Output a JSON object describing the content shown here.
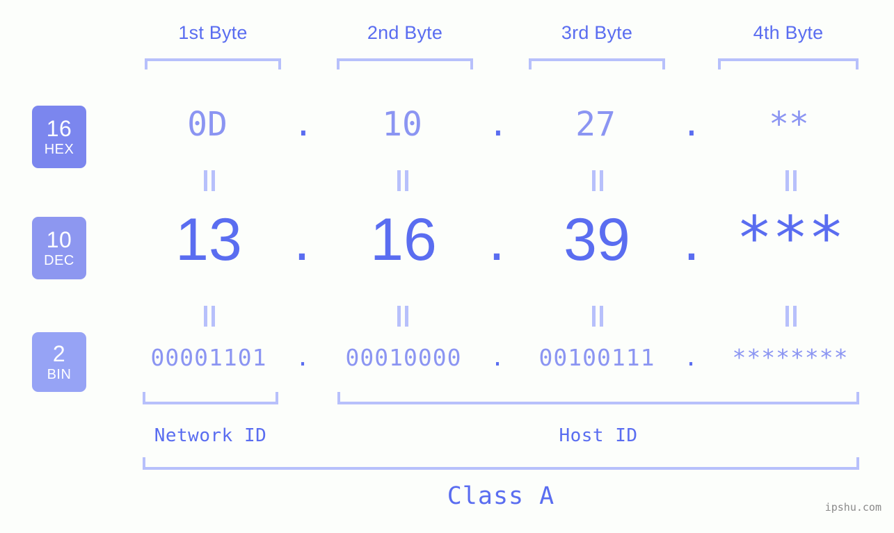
{
  "canvas": {
    "background_color": "#fcfefb",
    "accent_color": "#5a6df0",
    "light_accent_color": "#b7c0fb",
    "muted_value_color": "#8b95f2"
  },
  "byte_headers": [
    {
      "label": "1st Byte"
    },
    {
      "label": "2nd Byte"
    },
    {
      "label": "3rd Byte"
    },
    {
      "label": "4th Byte"
    }
  ],
  "radix_badges": [
    {
      "number": "16",
      "name": "HEX",
      "color": "#7b86ee"
    },
    {
      "number": "10",
      "name": "DEC",
      "color": "#8d97f0"
    },
    {
      "number": "2",
      "name": "BIN",
      "color": "#96a3f5"
    }
  ],
  "rows": {
    "hex": {
      "octets": [
        "0D",
        "10",
        "27",
        "**"
      ],
      "separator": "."
    },
    "dec": {
      "octets": [
        "13",
        "16",
        "39",
        "***"
      ],
      "separator": "."
    },
    "bin": {
      "octets": [
        "00001101",
        "00010000",
        "00100111",
        "********"
      ],
      "separator": "."
    }
  },
  "equals_marks": {
    "glyph": "||",
    "count_per_row": 4
  },
  "footer": {
    "network_id_label": "Network ID",
    "host_id_label": "Host ID",
    "class_label": "Class A"
  },
  "watermark": {
    "text": "ipshu.com"
  }
}
